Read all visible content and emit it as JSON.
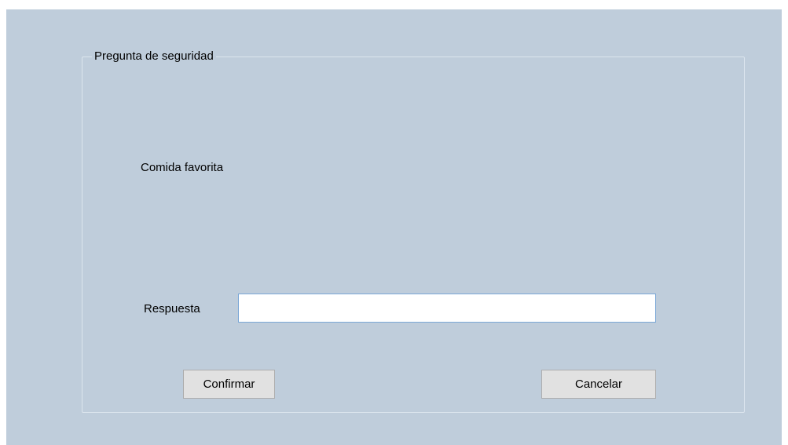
{
  "form": {
    "group_title": "Pregunta de seguridad",
    "question": "Comida favorita",
    "answer_label": "Respuesta",
    "answer_value": "",
    "answer_placeholder": "",
    "confirm_label": "Confirmar",
    "cancel_label": "Cancelar"
  },
  "colors": {
    "window_background": "#bfcddb",
    "input_border_focus": "#7aa7d6",
    "button_face": "#e1e1e1"
  }
}
